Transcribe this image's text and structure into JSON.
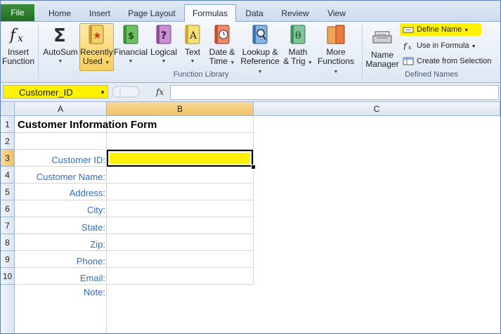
{
  "tabs": [
    {
      "label": "File",
      "active": false
    },
    {
      "label": "Home",
      "active": false
    },
    {
      "label": "Insert",
      "active": false
    },
    {
      "label": "Page Layout",
      "active": false
    },
    {
      "label": "Formulas",
      "active": true
    },
    {
      "label": "Data",
      "active": false
    },
    {
      "label": "Review",
      "active": false
    },
    {
      "label": "View",
      "active": false
    }
  ],
  "ribbon": {
    "insert_function": {
      "line1": "Insert",
      "line2": "Function",
      "icon": "fx-icon"
    },
    "autosum": {
      "label": "AutoSum",
      "icon": "sigma-icon"
    },
    "recently_used": {
      "line1": "Recently",
      "line2": "Used",
      "icon": "star-book-icon"
    },
    "financial": {
      "label": "Financial",
      "icon": "dollar-book-icon"
    },
    "logical": {
      "label": "Logical",
      "icon": "question-book-icon"
    },
    "text": {
      "label": "Text",
      "icon": "letter-book-icon"
    },
    "date_time": {
      "line1": "Date &",
      "line2": "Time",
      "icon": "clock-book-icon"
    },
    "lookup": {
      "line1": "Lookup &",
      "line2": "Reference",
      "icon": "magnifier-book-icon"
    },
    "math": {
      "line1": "Math",
      "line2": "& Trig",
      "icon": "theta-book-icon"
    },
    "more": {
      "line1": "More",
      "line2": "Functions",
      "icon": "stacked-books-icon"
    },
    "function_library_label": "Function Library",
    "name_manager": {
      "line1": "Name",
      "line2": "Manager",
      "icon": "name-manager-icon"
    },
    "define_name": "Define Name",
    "use_in_formula": "Use in Formula",
    "create_from_selection": "Create from Selection",
    "defined_names_label": "Defined Names"
  },
  "formula_bar": {
    "name_box": "Customer_ID",
    "fx_symbol": "fx",
    "formula": ""
  },
  "sheet": {
    "columns": [
      "A",
      "B",
      "C"
    ],
    "rows": [
      "1",
      "2",
      "3",
      "4",
      "5",
      "6",
      "7",
      "8",
      "9",
      "10"
    ],
    "title": "Customer Information Form",
    "labels": [
      "Customer ID:",
      "Customer Name:",
      "Address:",
      "City:",
      "State:",
      "Zip:",
      "Phone:",
      "Email:",
      "Note:"
    ],
    "selected_cell": "B3",
    "highlight_color": "#fff200"
  }
}
